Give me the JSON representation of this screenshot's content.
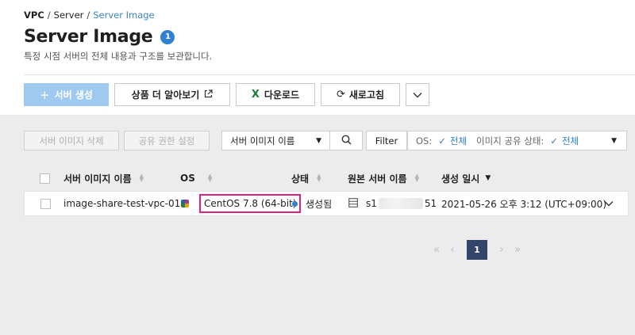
{
  "breadcrumb": {
    "items": [
      "VPC",
      "Server"
    ],
    "current": "Server Image",
    "separator": "/"
  },
  "header": {
    "title": "Server Image",
    "badge_count": "1",
    "subtitle": "특정 시점 서버의 전체 내용과 구조를 보관합니다."
  },
  "toolbar": {
    "create_label": "서버 생성",
    "learn_more_label": "상품 더 알아보기",
    "download_label": "다운로드",
    "refresh_label": "새로고침",
    "more_icon": "chevron-down-icon"
  },
  "actions": {
    "delete_label": "서버 이미지 삭제",
    "share_label": "공유 권한 설정"
  },
  "search": {
    "field_label": "서버 이미지 이름"
  },
  "filter": {
    "button_label": "Filter",
    "os_label": "OS:",
    "os_value": "전체",
    "share_label": "이미지 공유 상태:",
    "share_value": "전체"
  },
  "table": {
    "columns": [
      "서버 이미지 이름",
      "OS",
      "상태",
      "원본 서버 이름",
      "생성 일시"
    ],
    "rows": [
      {
        "name": "image-share-test-vpc-01",
        "os": "CentOS 7.8 (64-bit)",
        "status": "생성됨",
        "origin_server_prefix": "s1",
        "origin_server_suffix": "51",
        "created": "2021-05-26 오후 3:12 (UTC+09:00)"
      }
    ]
  },
  "pagination": {
    "current_page": "1"
  },
  "colors": {
    "accent": "#2f80d1",
    "primary_button": "#9fc9ef",
    "highlight": "#e0217d",
    "page_active": "#33456b"
  }
}
